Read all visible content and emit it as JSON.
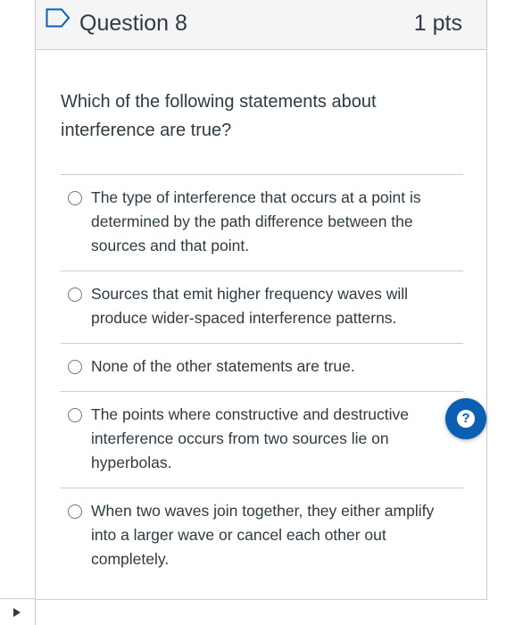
{
  "question": {
    "title": "Question 8",
    "points": "1 pts",
    "text": "Which of the following statements about interference are true?"
  },
  "answers": [
    {
      "label": "The type of interference that occurs at a point is determined by the path difference between the sources and that point.",
      "checked": false
    },
    {
      "label": "Sources that emit higher frequency waves will produce wider-spaced interference patterns.",
      "checked": false
    },
    {
      "label": "None of the other statements are true.",
      "checked": false
    },
    {
      "label": "The points where constructive and destructive interference occurs from two sources lie on hyperbolas.",
      "checked": false
    },
    {
      "label": "When two waves join together, they either amplify into a larger wave or cancel each other out completely.",
      "checked": false
    }
  ],
  "help": {
    "icon": "question-mark-icon",
    "glyph": "?",
    "color": "#0b5fb3"
  },
  "flag": {
    "icon": "flag-bookmark-icon"
  },
  "toggle": {
    "icon": "play-triangle-icon"
  }
}
